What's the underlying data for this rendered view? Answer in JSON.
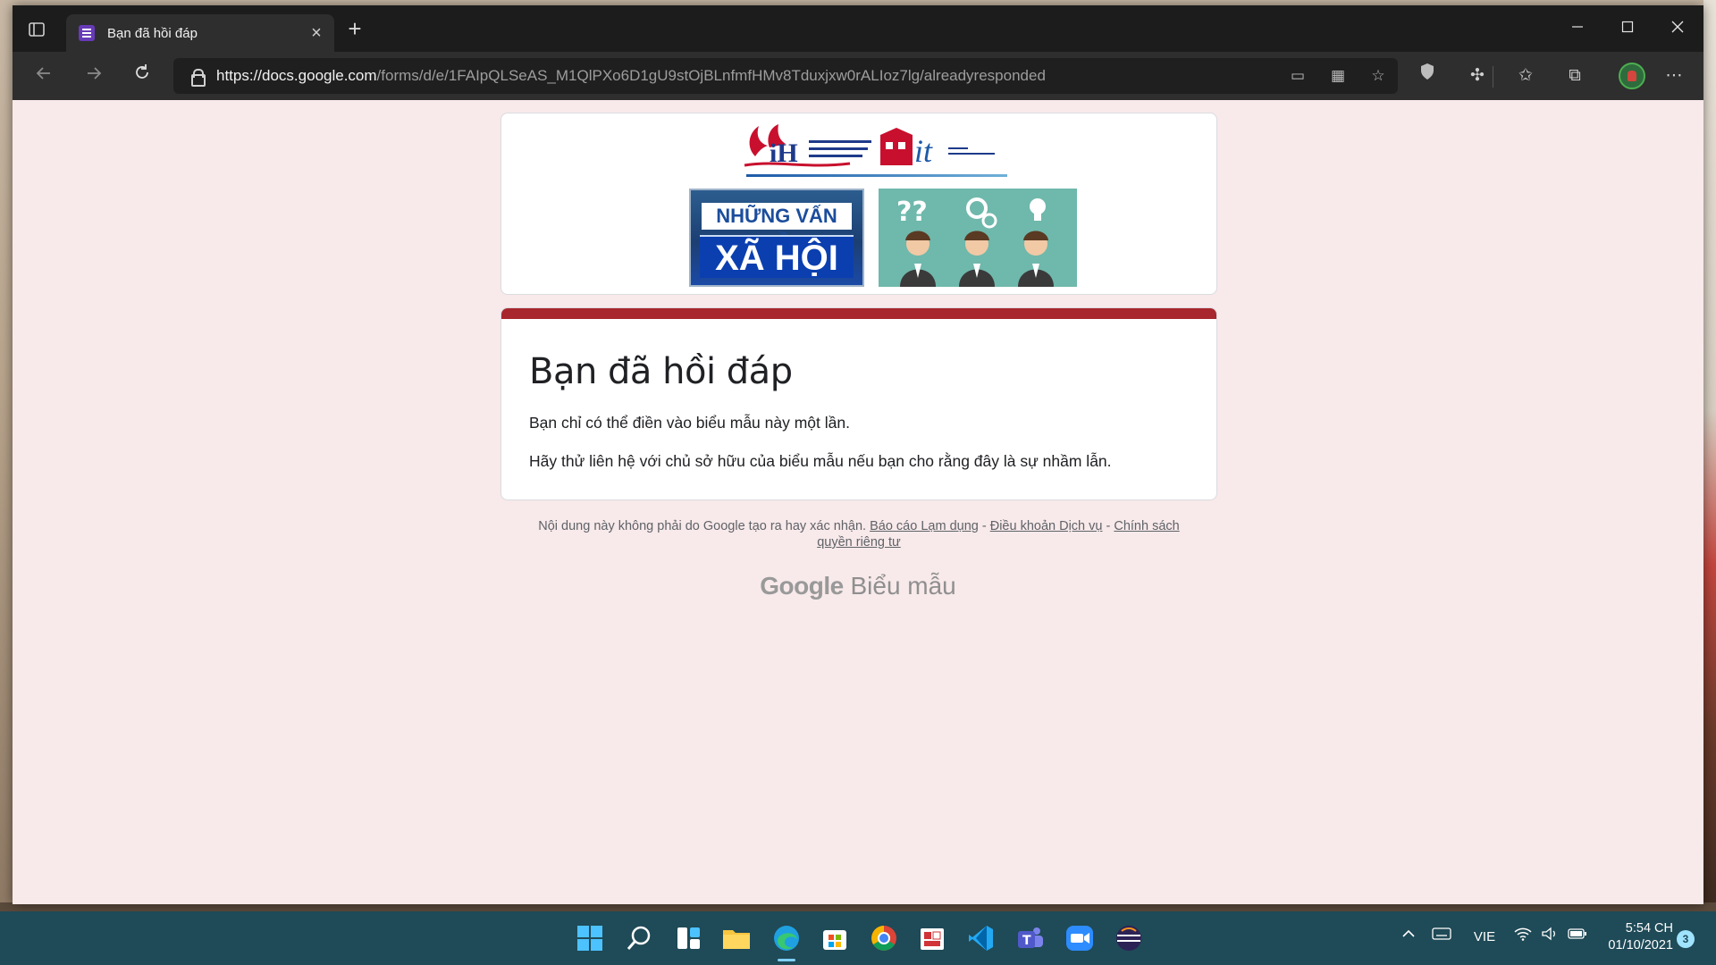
{
  "browser": {
    "tab_title": "Bạn đã hồi đáp",
    "tab_close": "×",
    "new_tab": "+",
    "url_host": "https://docs.google.com",
    "url_path": "/forms/d/e/1FAIpQLSeAS_M1QlPXo6D1gU9stOjBLnfmfHMv8Tduxjxw0rALIoz7lg/alreadyresponded",
    "icons": [
      "tab-actions-icon",
      "back-icon",
      "forward-icon",
      "refresh-icon",
      "lock-icon",
      "immersive-reader-icon",
      "apps-icon",
      "add-favorite-icon",
      "shield-icon",
      "extensions-icon",
      "favorites-icon",
      "collections-icon",
      "profile-avatar",
      "more-icon"
    ],
    "accent_color": "#673ab7"
  },
  "form": {
    "banner_left_line1": "NHỮNG VẤN ĐỀ",
    "banner_left_line2": "XÃ HỘI",
    "title": "Bạn đã hồi đáp",
    "message1": "Bạn chỉ có thể điền vào biểu mẫu này một lần.",
    "message2": "Hãy thử liên hệ với chủ sở hữu của biểu mẫu nếu bạn cho rằng đây là sự nhầm lẫn.",
    "theme_color": "#a8262d"
  },
  "footer": {
    "notice": "Nội dung này không phải do Google tạo ra hay xác nhận.",
    "report_link": "Báo cáo Lạm dụng",
    "sep1": " - ",
    "terms_link": "Điều khoản Dịch vụ",
    "sep2": " - ",
    "privacy_link": "Chính sách quyền riêng tư",
    "brand_google": "Google",
    "brand_forms": "Biểu mẫu"
  },
  "taskbar": {
    "apps": [
      "start-icon",
      "search-icon",
      "widgets-icon",
      "file-explorer-icon",
      "edge-icon",
      "store-icon",
      "chrome-icon",
      "sticky-notes-icon",
      "vscode-icon",
      "teams-icon",
      "zoom-icon",
      "eclipse-icon"
    ],
    "language": "VIE",
    "time": "5:54 CH",
    "date": "01/10/2021",
    "notification_count": "3"
  }
}
